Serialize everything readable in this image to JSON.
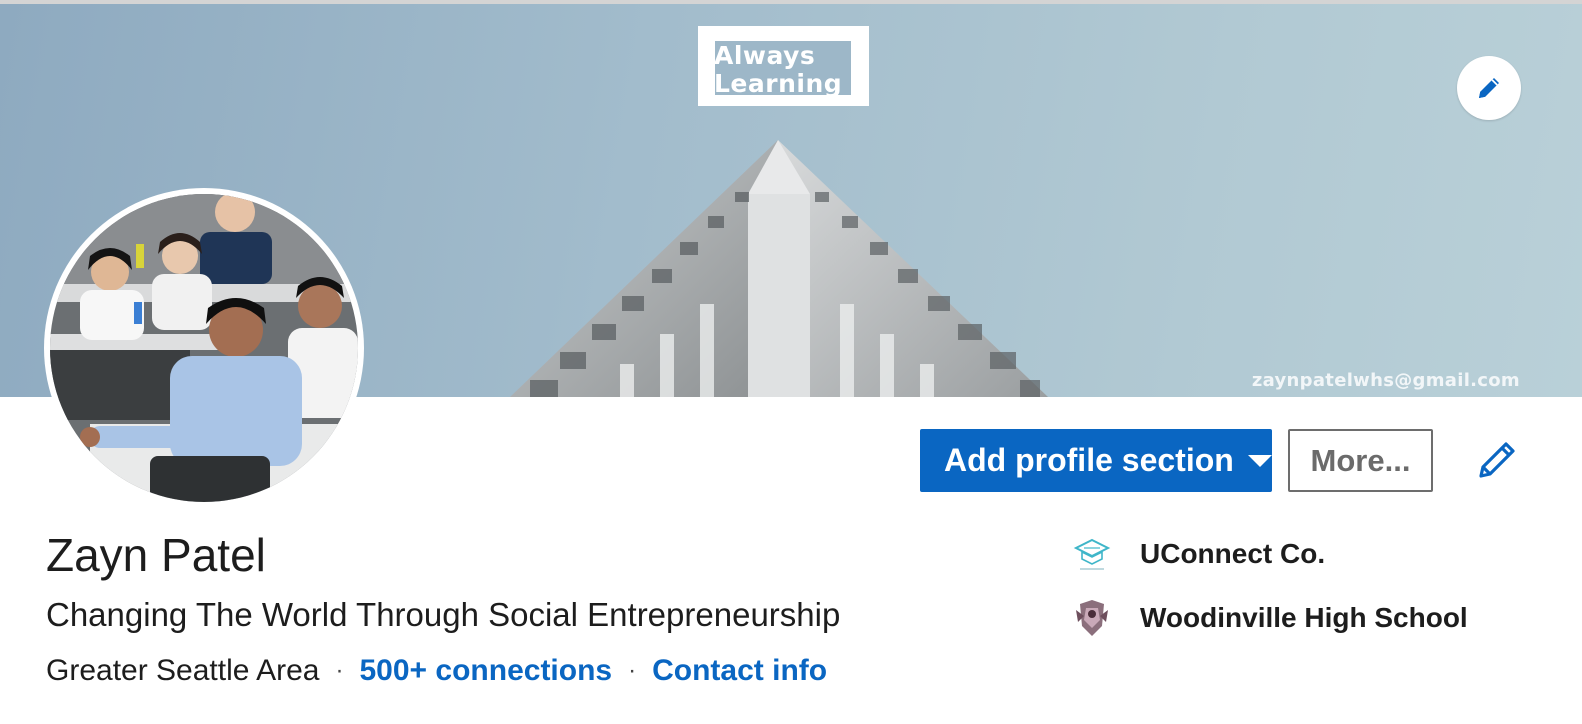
{
  "banner": {
    "logo_line1": "Always",
    "logo_line2": "Learning",
    "email": "zaynpatelwhs@gmail.com",
    "edit_icon": "pencil-icon"
  },
  "profile": {
    "name": "Zayn Patel",
    "headline": "Changing The World Through Social Entrepreneurship",
    "location": "Greater Seattle Area",
    "separator": "·",
    "connections": "500+ connections",
    "contact": "Contact info"
  },
  "actions": {
    "add_section_label": "Add profile section",
    "more_label": "More...",
    "edit_icon": "pencil-icon"
  },
  "organizations": [
    {
      "name": "UConnect Co.",
      "icon": "uconnect-logo"
    },
    {
      "name": "Woodinville High School",
      "icon": "school-crest-logo"
    }
  ],
  "colors": {
    "accent": "#0a66c2",
    "text": "#1d1d1d",
    "banner_sky": "#a8c1cf"
  }
}
